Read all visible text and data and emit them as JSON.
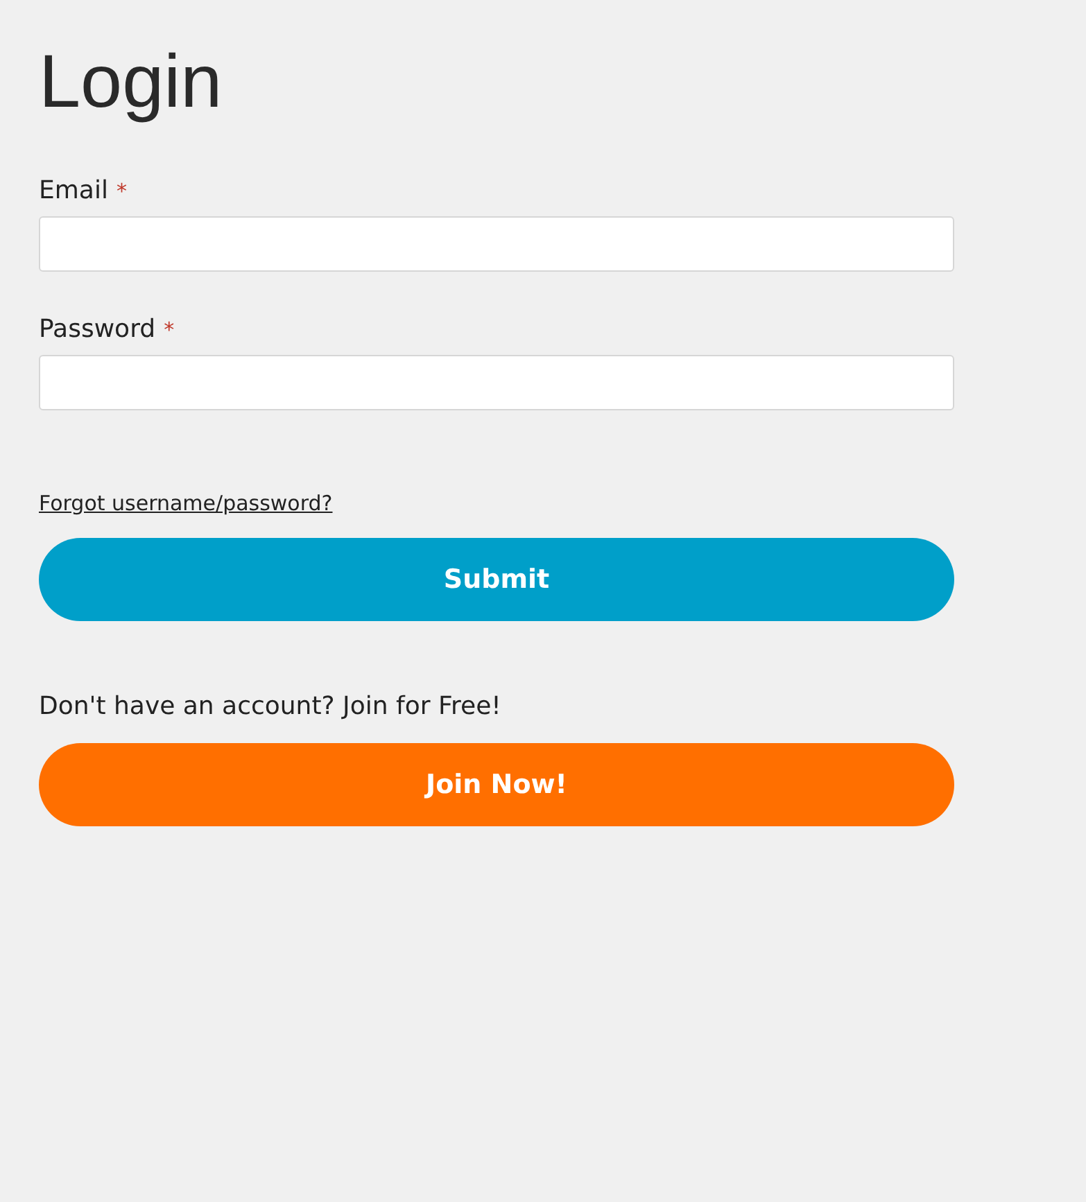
{
  "title": "Login",
  "fields": [
    {
      "label": "Email",
      "required_mark": "*"
    },
    {
      "label": "Password",
      "required_mark": "*"
    }
  ],
  "forgot_link": "Forgot username/password?",
  "submit_button": "Submit",
  "signup_prompt": "Don't have an account? Join for Free!",
  "join_button": "Join Now!"
}
